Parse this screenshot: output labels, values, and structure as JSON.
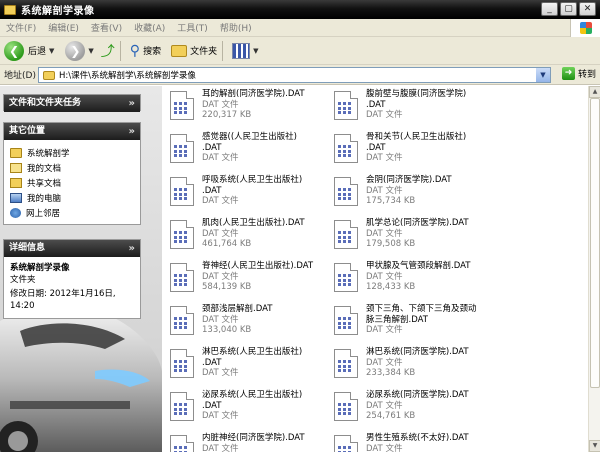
{
  "window": {
    "title": "系统解剖学录像",
    "buttons": [
      "_",
      "▢",
      "✕"
    ]
  },
  "menu": [
    "文件(F)",
    "编辑(E)",
    "查看(V)",
    "收藏(A)",
    "工具(T)",
    "帮助(H)"
  ],
  "toolbar": {
    "back_label": "后退",
    "search_label": "搜索",
    "folders_label": "文件夹"
  },
  "address": {
    "label": "地址(D)",
    "value": "H:\\课件\\系统解剖学\\系统解剖学录像",
    "go_label": "转到"
  },
  "sidebar": {
    "tasks_title": "文件和文件夹任务",
    "other_title": "其它位置",
    "other_items": [
      {
        "label": "系统解剖学",
        "icon": "folder-icon"
      },
      {
        "label": "我的文档",
        "icon": "documents-icon"
      },
      {
        "label": "共享文档",
        "icon": "shared-folder-icon"
      },
      {
        "label": "我的电脑",
        "icon": "computer-icon"
      },
      {
        "label": "网上邻居",
        "icon": "network-icon"
      }
    ],
    "details_title": "详细信息",
    "details": {
      "name": "系统解剖学录像",
      "type": "文件夹",
      "modified": "修改日期: 2012年1月16日, 14:20"
    }
  },
  "files": [
    {
      "name_lines": [
        "耳的解剖(同济医学院).DAT"
      ],
      "type": "DAT 文件",
      "size": "220,317 KB"
    },
    {
      "name_lines": [
        "腹前壁与腹膜(同济医学院)",
        ".DAT"
      ],
      "type": "DAT 文件",
      "size": ""
    },
    {
      "name_lines": [
        "感觉器((人民卫生出版社)",
        ".DAT"
      ],
      "type": "DAT 文件",
      "size": ""
    },
    {
      "name_lines": [
        "骨和关节(人民卫生出版社)",
        ".DAT"
      ],
      "type": "DAT 文件",
      "size": ""
    },
    {
      "name_lines": [
        "呼吸系统(人民卫生出版社)",
        ".DAT"
      ],
      "type": "DAT 文件",
      "size": ""
    },
    {
      "name_lines": [
        "会阴(同济医学院).DAT"
      ],
      "type": "DAT 文件",
      "size": "175,734 KB"
    },
    {
      "name_lines": [
        "肌肉(人民卫生出版社).DAT"
      ],
      "type": "DAT 文件",
      "size": "461,764 KB"
    },
    {
      "name_lines": [
        "肌学总论(同济医学院).DAT"
      ],
      "type": "DAT 文件",
      "size": "179,508 KB"
    },
    {
      "name_lines": [
        "脊神经(人民卫生出版社).DAT"
      ],
      "type": "DAT 文件",
      "size": "584,139 KB"
    },
    {
      "name_lines": [
        "甲状腺及气管颈段解剖.DAT"
      ],
      "type": "DAT 文件",
      "size": "128,433 KB"
    },
    {
      "name_lines": [
        "颈部浅层解剖.DAT"
      ],
      "type": "DAT 文件",
      "size": "133,040 KB"
    },
    {
      "name_lines": [
        "颈下三角、下颌下三角及颈动",
        "脉三角解剖.DAT"
      ],
      "type": "DAT 文件",
      "size": ""
    },
    {
      "name_lines": [
        "淋巴系统(人民卫生出版社)",
        ".DAT"
      ],
      "type": "DAT 文件",
      "size": ""
    },
    {
      "name_lines": [
        "淋巴系统(同济医学院).DAT"
      ],
      "type": "DAT 文件",
      "size": "233,384 KB"
    },
    {
      "name_lines": [
        "泌尿系统(人民卫生出版社)",
        ".DAT"
      ],
      "type": "DAT 文件",
      "size": ""
    },
    {
      "name_lines": [
        "泌尿系统(同济医学院).DAT"
      ],
      "type": "DAT 文件",
      "size": "254,761 KB"
    },
    {
      "name_lines": [
        "内脏神经(同济医学院).DAT"
      ],
      "type": "DAT 文件",
      "size": ""
    },
    {
      "name_lines": [
        "男性生殖系统(不太好).DAT"
      ],
      "type": "DAT 文件",
      "size": ""
    }
  ]
}
